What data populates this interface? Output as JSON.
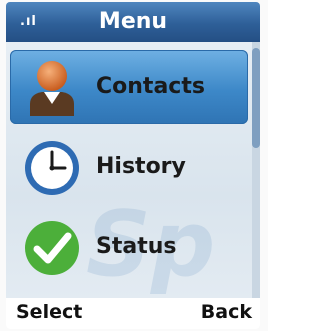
{
  "status": {
    "signal": ".ıl"
  },
  "header": {
    "title": "Menu"
  },
  "menu": {
    "items": [
      {
        "label": "Contacts",
        "icon": "contacts-icon",
        "selected": true
      },
      {
        "label": "History",
        "icon": "clock-icon",
        "selected": false
      },
      {
        "label": "Status",
        "icon": "checkmark-icon",
        "selected": false
      }
    ]
  },
  "softkeys": {
    "left": "Select",
    "right": "Back"
  },
  "colors": {
    "header": "#2e5f98",
    "selection": "#3d88c8",
    "status_green": "#4caf3a"
  }
}
